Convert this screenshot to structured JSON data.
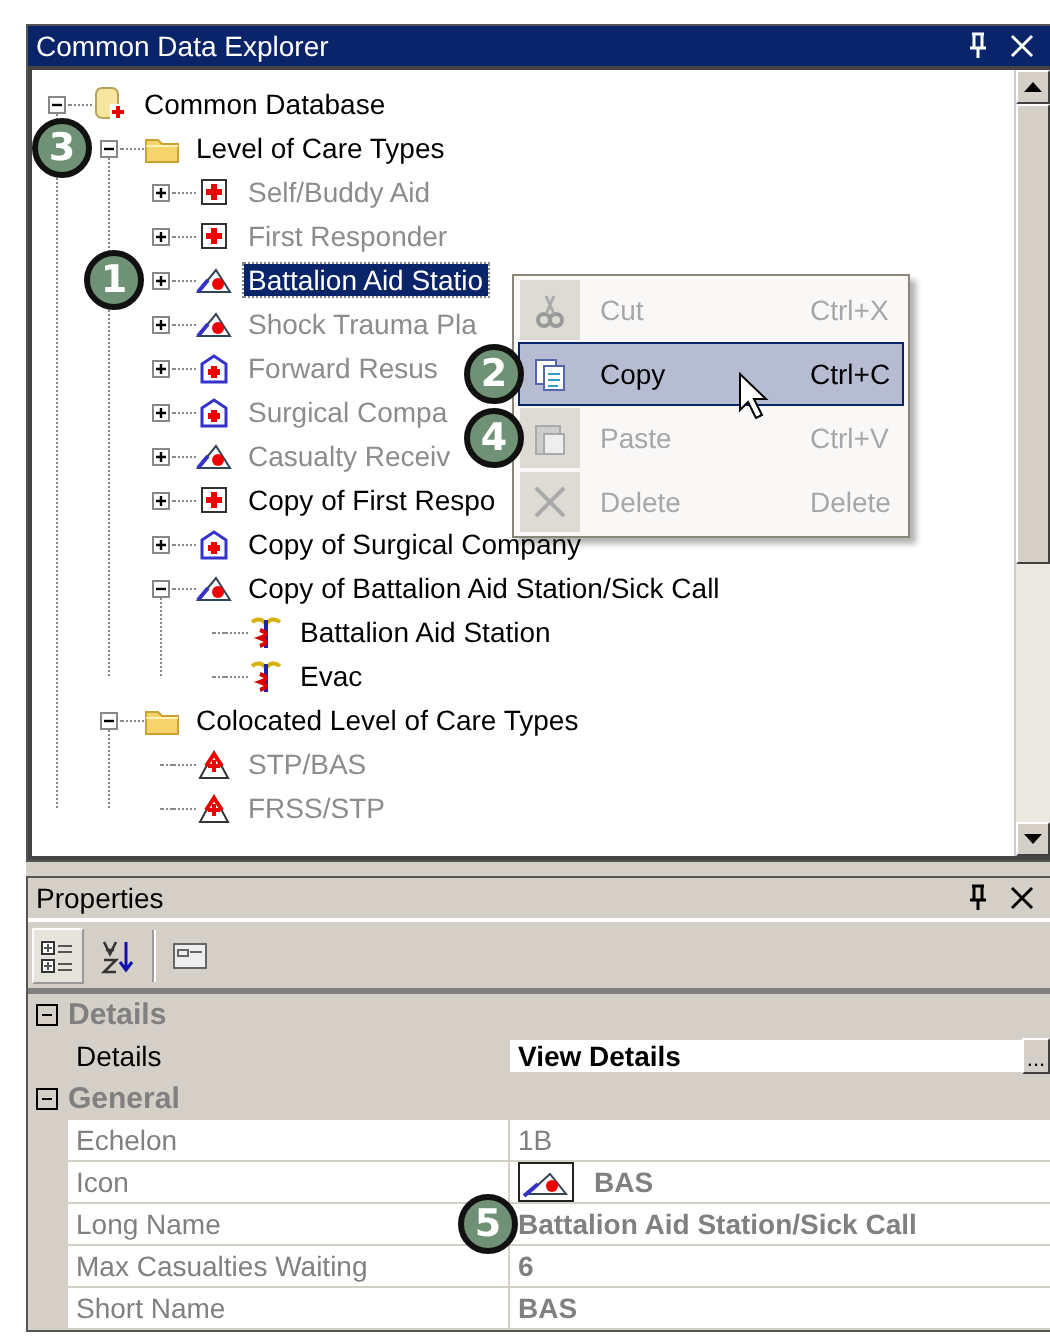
{
  "explorer": {
    "title": "Common Data Explorer",
    "tree": [
      {
        "label": "Common Database",
        "kind": "database",
        "has_expander": true,
        "expanded": true,
        "dimmed": false,
        "selected": false,
        "children": [
          {
            "label": "Level of Care Types",
            "kind": "folder",
            "has_expander": true,
            "expanded": true,
            "dimmed": false,
            "selected": false,
            "callout": "3",
            "children": [
              {
                "label": "Self/Buddy Aid",
                "kind": "cross",
                "has_expander": true,
                "expanded": false,
                "dimmed": true,
                "selected": false
              },
              {
                "label": "First Responder",
                "kind": "cross",
                "has_expander": true,
                "expanded": false,
                "dimmed": true,
                "selected": false
              },
              {
                "label": "Battalion Aid Statio",
                "kind": "tent",
                "has_expander": true,
                "expanded": false,
                "dimmed": false,
                "selected": true,
                "callout": "1"
              },
              {
                "label": "Shock Trauma Pla",
                "kind": "tent",
                "has_expander": true,
                "expanded": false,
                "dimmed": true,
                "selected": false
              },
              {
                "label": "Forward Resus",
                "kind": "building",
                "has_expander": true,
                "expanded": false,
                "dimmed": true,
                "selected": false
              },
              {
                "label": "Surgical Compa",
                "kind": "building",
                "has_expander": true,
                "expanded": false,
                "dimmed": true,
                "selected": false
              },
              {
                "label": "Casualty Receiv",
                "kind": "tent",
                "has_expander": true,
                "expanded": false,
                "dimmed": true,
                "selected": false
              },
              {
                "label": "Copy of First Respo",
                "kind": "cross",
                "has_expander": true,
                "expanded": false,
                "dimmed": false,
                "selected": false
              },
              {
                "label": "Copy of Surgical Company",
                "kind": "building",
                "has_expander": true,
                "expanded": false,
                "dimmed": false,
                "selected": false
              },
              {
                "label": "Copy of Battalion Aid Station/Sick Call",
                "kind": "tent",
                "has_expander": true,
                "expanded": true,
                "dimmed": false,
                "selected": false,
                "children": [
                  {
                    "label": "Battalion Aid Station",
                    "kind": "caduceus",
                    "has_expander": false,
                    "dimmed": false,
                    "selected": false
                  },
                  {
                    "label": "Evac",
                    "kind": "caduceus",
                    "has_expander": false,
                    "dimmed": false,
                    "selected": false
                  }
                ]
              }
            ]
          },
          {
            "label": "Colocated Level of Care Types",
            "kind": "folder",
            "has_expander": true,
            "expanded": true,
            "dimmed": false,
            "selected": false,
            "children": [
              {
                "label": "STP/BAS",
                "kind": "stacked",
                "has_expander": false,
                "dimmed": true,
                "selected": false
              },
              {
                "label": "FRSS/STP",
                "kind": "stacked",
                "has_expander": false,
                "dimmed": true,
                "selected": false
              }
            ]
          }
        ]
      }
    ]
  },
  "context_menu": {
    "items": [
      {
        "label": "Cut",
        "shortcut": "Ctrl+X",
        "kind": "cut",
        "disabled": true,
        "selected": false
      },
      {
        "label": "Copy",
        "shortcut": "Ctrl+C",
        "kind": "copy",
        "disabled": false,
        "selected": true,
        "callout": "2"
      },
      {
        "label": "Paste",
        "shortcut": "Ctrl+V",
        "kind": "paste",
        "disabled": true,
        "selected": false,
        "callout": "4"
      },
      {
        "label": "Delete",
        "shortcut": "Delete",
        "kind": "delete",
        "disabled": true,
        "selected": false
      }
    ]
  },
  "properties": {
    "title": "Properties",
    "toolbar": [
      {
        "kind": "categorized",
        "selected": true
      },
      {
        "kind": "alphabetical",
        "selected": false
      },
      {
        "kind": "pages",
        "selected": false
      }
    ],
    "categories": [
      {
        "name": "Details",
        "expanded": true,
        "rows": [
          {
            "name": "Details",
            "value": "View Details",
            "kind": "button",
            "button_label": "...",
            "readonly": false,
            "bold": true
          }
        ]
      },
      {
        "name": "General",
        "expanded": true,
        "rows": [
          {
            "name": "Echelon",
            "value": "1B",
            "kind": "text",
            "readonly": true,
            "bold": false
          },
          {
            "name": "Icon",
            "value": "BAS",
            "kind": "icon",
            "readonly": true,
            "bold": true
          },
          {
            "name": "Long Name",
            "value": "Battalion Aid Station/Sick Call",
            "kind": "text",
            "readonly": true,
            "bold": true,
            "callout": "5"
          },
          {
            "name": "Max Casualties Waiting",
            "value": "6",
            "kind": "text",
            "readonly": true,
            "bold": true
          },
          {
            "name": "Short Name",
            "value": "BAS",
            "kind": "text",
            "readonly": true,
            "bold": true
          }
        ]
      }
    ]
  }
}
